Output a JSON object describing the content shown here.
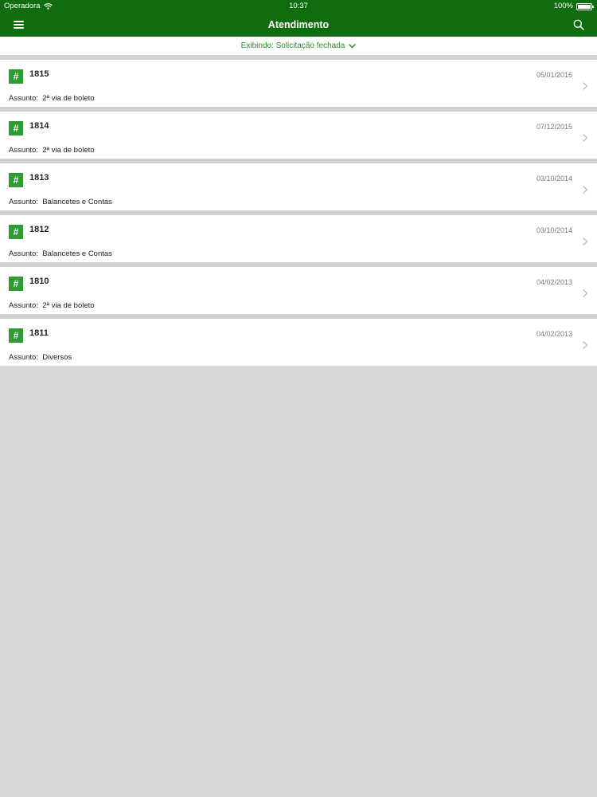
{
  "status_bar": {
    "carrier": "Operadora",
    "time": "10:37",
    "battery": "100%",
    "wifi_icon": "wifi-icon",
    "battery_icon": "battery-icon"
  },
  "nav": {
    "title": "Atendimento",
    "menu_icon": "menu-icon",
    "search_icon": "search-icon"
  },
  "filter": {
    "label": "Exibindo: Solicitação fechada",
    "icon": "chevron-down-icon"
  },
  "subject_label": "Assunto:",
  "tickets": [
    {
      "id": "1815",
      "date": "05/01/2016",
      "subject": "2ª via de boleto"
    },
    {
      "id": "1814",
      "date": "07/12/2015",
      "subject": "2ª via de boleto"
    },
    {
      "id": "1813",
      "date": "03/10/2014",
      "subject": "Balancetes e Contas"
    },
    {
      "id": "1812",
      "date": "03/10/2014",
      "subject": "Balancetes e Contas"
    },
    {
      "id": "1810",
      "date": "04/02/2013",
      "subject": "2ª via de boleto"
    },
    {
      "id": "1811",
      "date": "04/02/2013",
      "subject": "Diversos"
    }
  ],
  "ticket_badge": "#",
  "colors": {
    "header": "#0f6d0f",
    "accent": "#2f9c33",
    "background": "#d8d7da"
  }
}
